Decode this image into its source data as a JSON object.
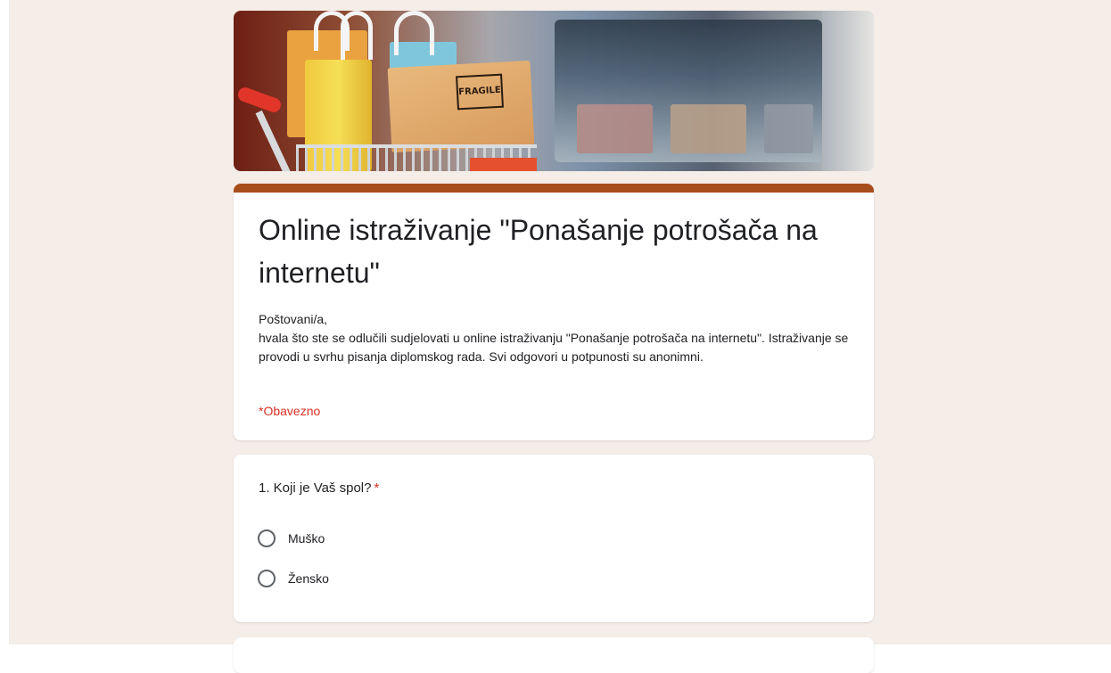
{
  "form": {
    "title": "Online istraživanje \"Ponašanje potrošača na internetu\"",
    "description": [
      "Poštovani/a,",
      "hvala što ste se odlučili sudjelovati u online istraživanju \"Ponašanje potrošača na internetu\". Istraživanje se provodi u svrhu pisanja diplomskog rada. Svi odgovori u potpunosti su anonimni."
    ],
    "required_note": "*Obavezno",
    "accent_color": "#a84e1c",
    "background_color": "#f5ede8",
    "banner_box_label": "FRAGILE"
  },
  "questions": [
    {
      "title": "1. Koji je Vaš spol?",
      "required_marker": "*",
      "options": [
        "Muško",
        "Žensko"
      ]
    }
  ],
  "icons": {
    "radio": "radio-unchecked-icon"
  }
}
